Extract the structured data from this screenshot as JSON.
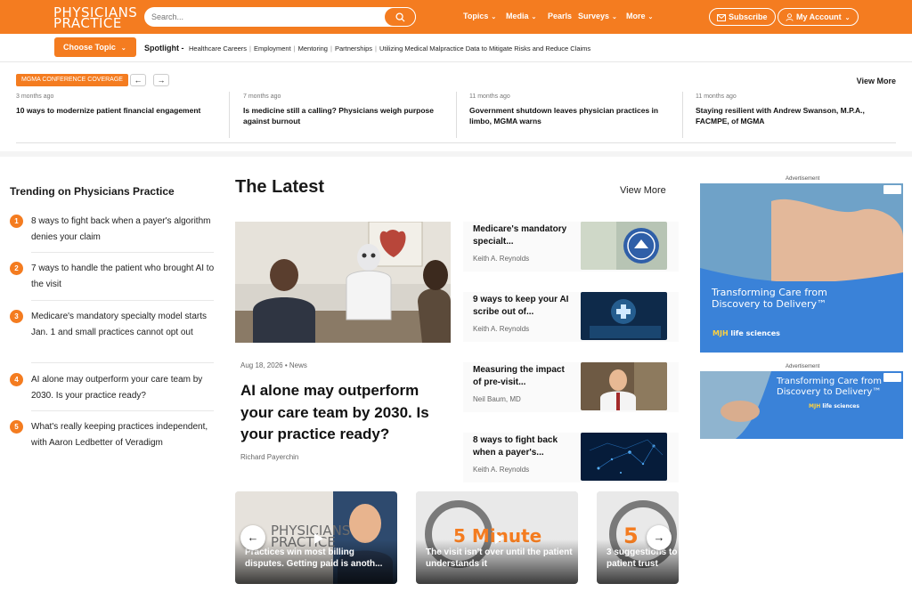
{
  "header": {
    "logo_line1": "PHYSICIANS",
    "logo_line2": "PRACTICE",
    "search_placeholder": "Search...",
    "nav": [
      {
        "label": "Topics",
        "dropdown": true
      },
      {
        "label": "Media",
        "dropdown": true
      },
      {
        "label": "Pearls",
        "dropdown": false
      },
      {
        "label": "Surveys",
        "dropdown": true
      },
      {
        "label": "More",
        "dropdown": true
      }
    ],
    "subscribe_label": "Subscribe",
    "account_label": "My Account",
    "brand_color": "#f47c20"
  },
  "spotlight": {
    "choose_label": "Choose Topic",
    "label": "Spotlight -",
    "links": [
      "Healthcare Careers",
      "Employment",
      "Mentoring",
      "Partnerships",
      "Utilizing Medical Malpractice Data to Mitigate Risks and Reduce Claims"
    ]
  },
  "conference": {
    "tag": "MGMA CONFERENCE COVERAGE",
    "view_more": "View More",
    "items": [
      {
        "ago": "3 months ago",
        "title": "10 ways to modernize patient financial engagement"
      },
      {
        "ago": "7 months ago",
        "title": "Is medicine still a calling? Physicians weigh purpose against burnout"
      },
      {
        "ago": "11 months ago",
        "title": "Government shutdown leaves physician practices in limbo, MGMA warns"
      },
      {
        "ago": "11 months ago",
        "title": "Staying resilient with Andrew Swanson, M.P.A., FACMPE, of MGMA"
      }
    ]
  },
  "trending": {
    "title": "Trending on Physicians Practice",
    "items": [
      {
        "num": "1",
        "text": "8 ways to fight back when a payer's algorithm denies your claim"
      },
      {
        "num": "2",
        "text": "7 ways to handle the patient who brought AI to the visit"
      },
      {
        "num": "3",
        "text": "Medicare's mandatory specialty model starts Jan. 1 and small practices cannot opt out"
      },
      {
        "num": "4",
        "text": "AI alone may outperform your care team by 2030. Is your practice ready?"
      },
      {
        "num": "5",
        "text": "What's really keeping practices independent, with Aaron Ledbetter of Veradigm"
      }
    ]
  },
  "latest": {
    "title": "The Latest",
    "view_more": "View More",
    "hero": {
      "date": "Aug 18, 2026",
      "category": "News",
      "title": "AI alone may outperform your care team by 2030. Is your practice ready?",
      "author": "Richard Payerchin"
    },
    "side": [
      {
        "title": "Medicare's mandatory specialt...",
        "author": "Keith A. Reynolds"
      },
      {
        "title": "9 ways to keep your AI scribe out of...",
        "author": "Keith A. Reynolds"
      },
      {
        "title": "Measuring the impact of pre-visit...",
        "author": "Neil Baum, MD"
      },
      {
        "title": "8 ways to fight back when a payer's...",
        "author": "Keith A. Reynolds"
      }
    ]
  },
  "videos": [
    {
      "title": "Practices win most billing disputes. Getting paid is anoth...",
      "overlay": "PHYSICIANS PRACTICE"
    },
    {
      "title": "The visit isn't over until the patient understands it",
      "overlay": "5 Minute"
    },
    {
      "title": "3 suggestions to patient trust",
      "overlay": "5"
    }
  ],
  "ads": {
    "label": "Advertisement",
    "ad1_text": "Transforming Care from Discovery to Delivery™",
    "ad2_text": "Transforming Care from Discovery to Delivery™",
    "brand": "life sciences"
  }
}
